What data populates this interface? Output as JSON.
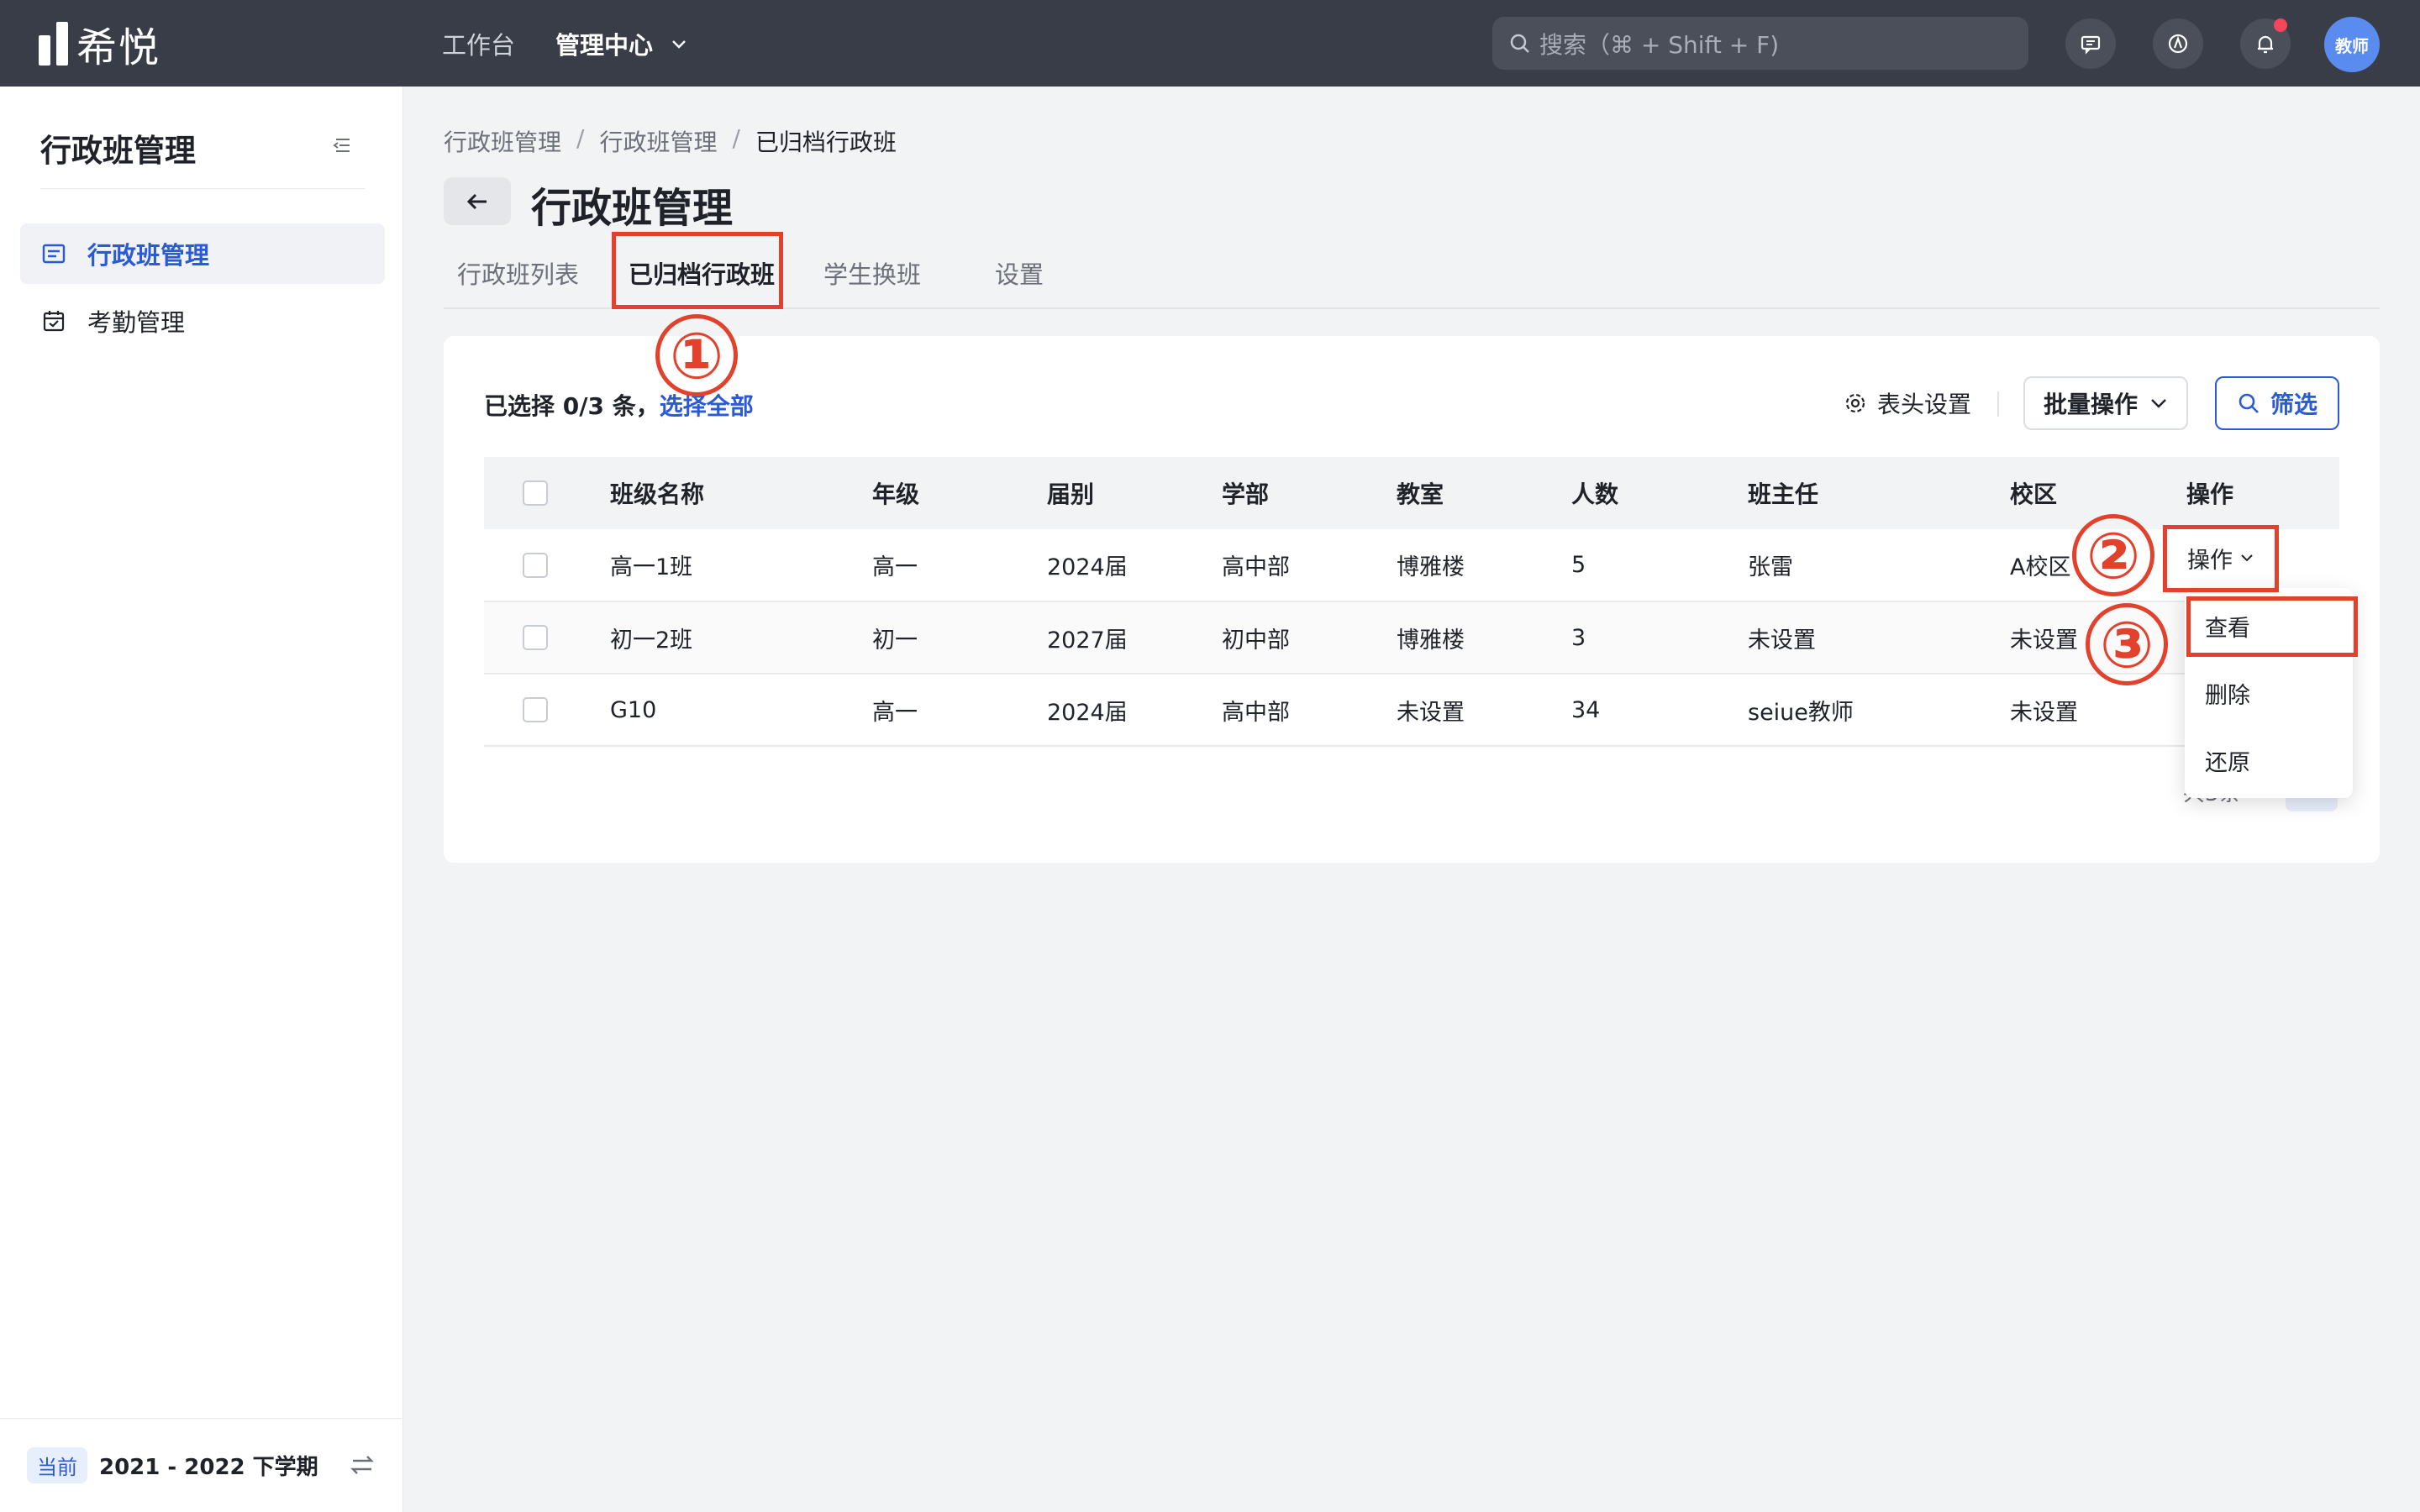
{
  "topbar": {
    "logo_text": "希悦",
    "nav": {
      "workbench": "工作台",
      "admin_center": "管理中心"
    },
    "search_placeholder": "搜索（⌘ + Shift + F)",
    "avatar_text": "教师",
    "colors": {
      "background": "#393d47",
      "notification_dot": "#f5455a",
      "avatar": "#5a8cf0"
    }
  },
  "sidebar": {
    "title": "行政班管理",
    "items": [
      {
        "label": "行政班管理",
        "icon": "class-list-icon",
        "active": true
      },
      {
        "label": "考勤管理",
        "icon": "calendar-check-icon",
        "active": false
      }
    ],
    "term": {
      "badge": "当前",
      "label": "2021 - 2022 下学期"
    }
  },
  "breadcrumb": [
    "行政班管理",
    "行政班管理",
    "已归档行政班"
  ],
  "page_title": "行政班管理",
  "tabs": [
    {
      "label": "行政班列表",
      "active": false
    },
    {
      "label": "已归档行政班",
      "active": true
    },
    {
      "label": "学生换班",
      "active": false
    },
    {
      "label": "设置",
      "active": false
    }
  ],
  "toolbar": {
    "selection_prefix": "已选择 0/3 条，",
    "select_all": "选择全部",
    "column_settings": "表头设置",
    "batch_ops": "批量操作",
    "filter": "筛选"
  },
  "table": {
    "headers": [
      "班级名称",
      "年级",
      "届别",
      "学部",
      "教室",
      "人数",
      "班主任",
      "校区",
      "操作"
    ],
    "rows": [
      {
        "name": "高一1班",
        "grade": "高一",
        "cohort": "2024届",
        "division": "高中部",
        "room": "博雅楼",
        "count": "5",
        "teacher": "张雷",
        "campus": "A校区",
        "action": "操作"
      },
      {
        "name": "初一2班",
        "grade": "初一",
        "cohort": "2027届",
        "division": "初中部",
        "room": "博雅楼",
        "count": "3",
        "teacher": "未设置",
        "campus": "未设置"
      },
      {
        "name": "G10",
        "grade": "高一",
        "cohort": "2024届",
        "division": "高中部",
        "room": "未设置",
        "count": "34",
        "teacher": "seiue教师",
        "campus": "未设置"
      }
    ]
  },
  "pagination": {
    "total": "共3条",
    "current_page": "1"
  },
  "action_menu": [
    "查看",
    "删除",
    "还原"
  ],
  "annotations": {
    "marker_1": "①",
    "marker_2": "②",
    "marker_3": "③",
    "color": "#e2412b"
  },
  "accent_color": "#2a5ad7"
}
